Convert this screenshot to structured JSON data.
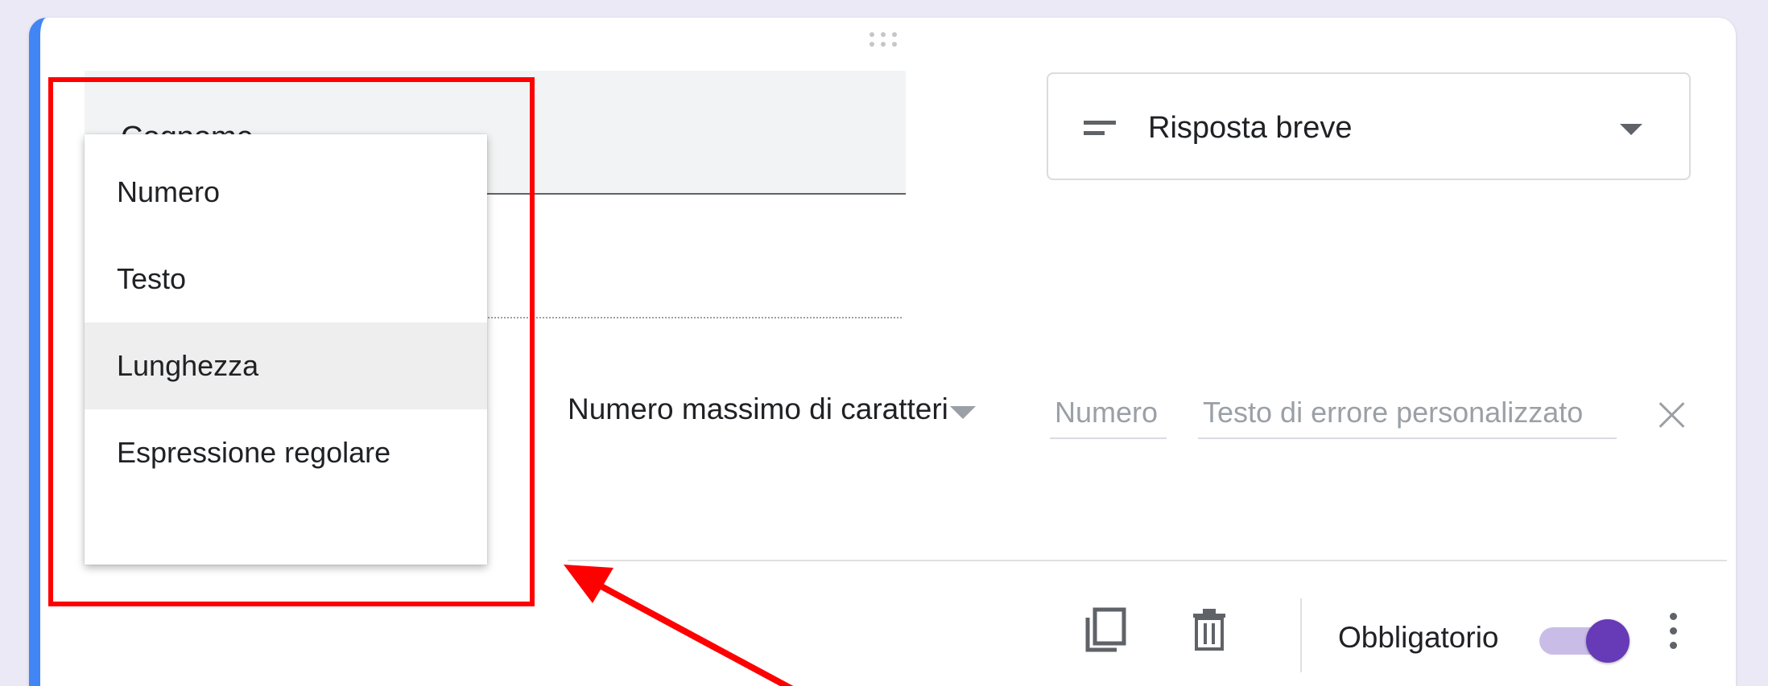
{
  "question": {
    "title": "Cognome",
    "type_label": "Risposta breve"
  },
  "validation": {
    "rule_label": "Numero massimo di caratteri",
    "number_placeholder": "Numero",
    "error_placeholder": "Testo di errore personalizzato"
  },
  "menu": {
    "items": [
      {
        "label": "Numero"
      },
      {
        "label": "Testo"
      },
      {
        "label": "Lunghezza"
      },
      {
        "label": "Espressione regolare"
      }
    ],
    "active_index": 2
  },
  "footer": {
    "required_label": "Obbligatorio",
    "required_on": true
  },
  "icons": {
    "drag": "drag-handle-icon",
    "type": "short-text-icon",
    "close": "close-icon",
    "copy": "content-copy-icon",
    "delete": "trash-icon",
    "more": "more-vert-icon"
  },
  "colors": {
    "accent": "#4285f4",
    "toggle": "#673ab7",
    "annotation": "#ff0000"
  }
}
